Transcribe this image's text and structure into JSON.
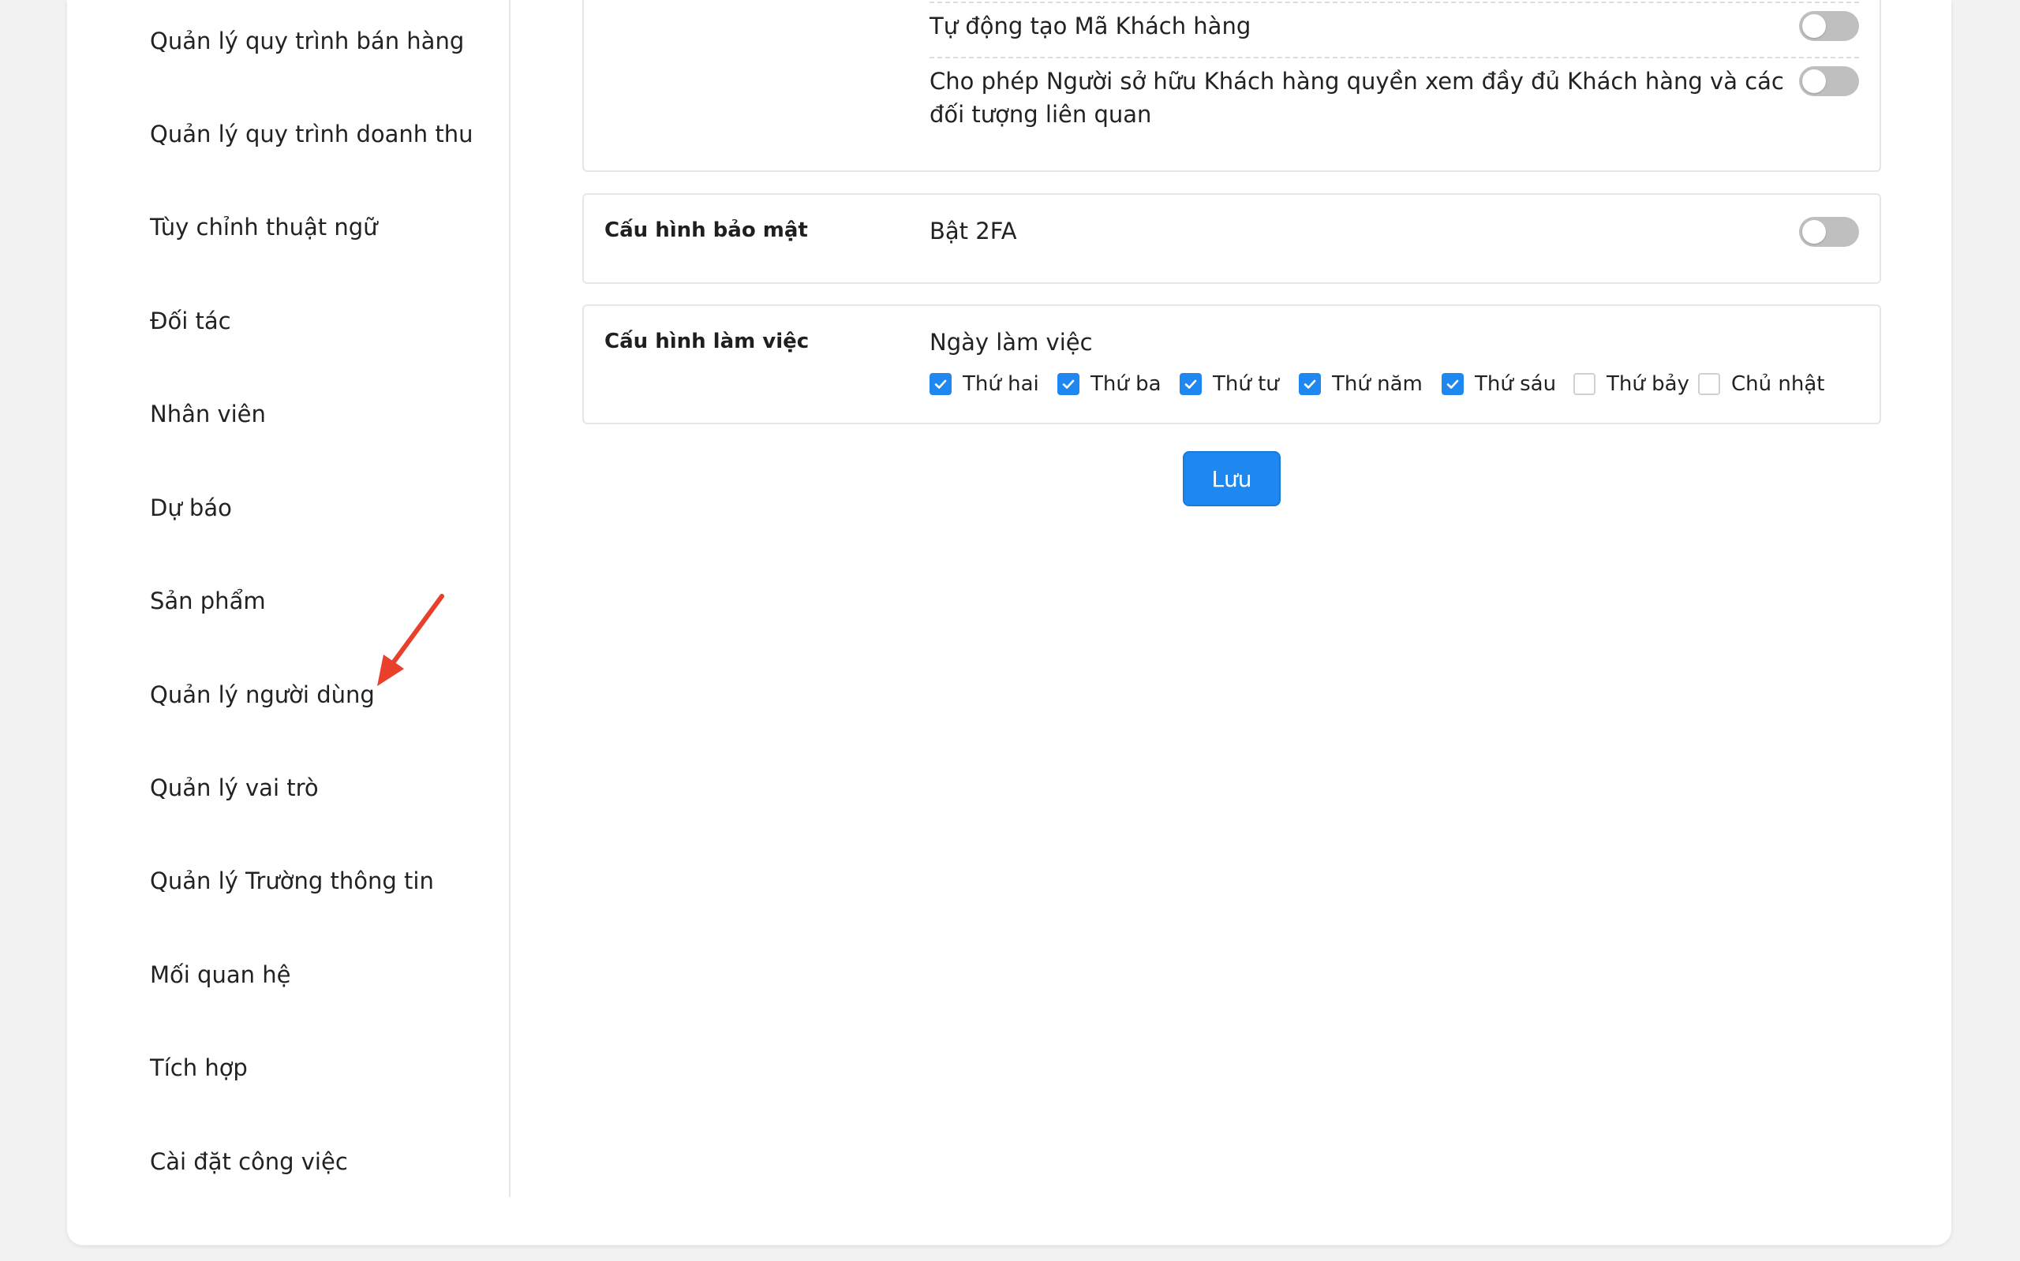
{
  "sidebar": {
    "items": [
      {
        "label": "Quản lý quy trình bán hàng"
      },
      {
        "label": "Quản lý quy trình doanh thu"
      },
      {
        "label": "Tùy chỉnh thuật ngữ"
      },
      {
        "label": "Đối tác"
      },
      {
        "label": "Nhân viên"
      },
      {
        "label": "Dự báo"
      },
      {
        "label": "Sản phẩm"
      },
      {
        "label": "Quản lý người dùng"
      },
      {
        "label": "Quản lý vai trò"
      },
      {
        "label": "Quản lý Trường thông tin"
      },
      {
        "label": "Mối quan hệ"
      },
      {
        "label": "Tích hợp"
      },
      {
        "label": "Cài đặt công việc"
      }
    ]
  },
  "customer_settings": {
    "auto_code_label": "Tự động tạo Mã Khách hàng",
    "auto_code_enabled": false,
    "owner_full_view_label": "Cho phép Người sở hữu Khách hàng quyền xem đầy đủ Khách hàng và các đối tượng liên quan",
    "owner_full_view_enabled": false
  },
  "security": {
    "title": "Cấu hình bảo mật",
    "twofa_label": "Bật 2FA",
    "twofa_enabled": false
  },
  "working": {
    "title": "Cấu hình làm việc",
    "days_label": "Ngày làm việc",
    "days": [
      {
        "label": "Thứ hai",
        "checked": true
      },
      {
        "label": "Thứ ba",
        "checked": true
      },
      {
        "label": "Thứ tư",
        "checked": true
      },
      {
        "label": "Thứ năm",
        "checked": true
      },
      {
        "label": "Thứ sáu",
        "checked": true
      },
      {
        "label": "Thứ bảy",
        "checked": false
      },
      {
        "label": "Chủ nhật",
        "checked": false
      }
    ]
  },
  "actions": {
    "save_label": "Lưu"
  },
  "colors": {
    "accent": "#1e88f0",
    "toggle_off": "#bfbfbf",
    "annotation_arrow": "#e8402c"
  }
}
